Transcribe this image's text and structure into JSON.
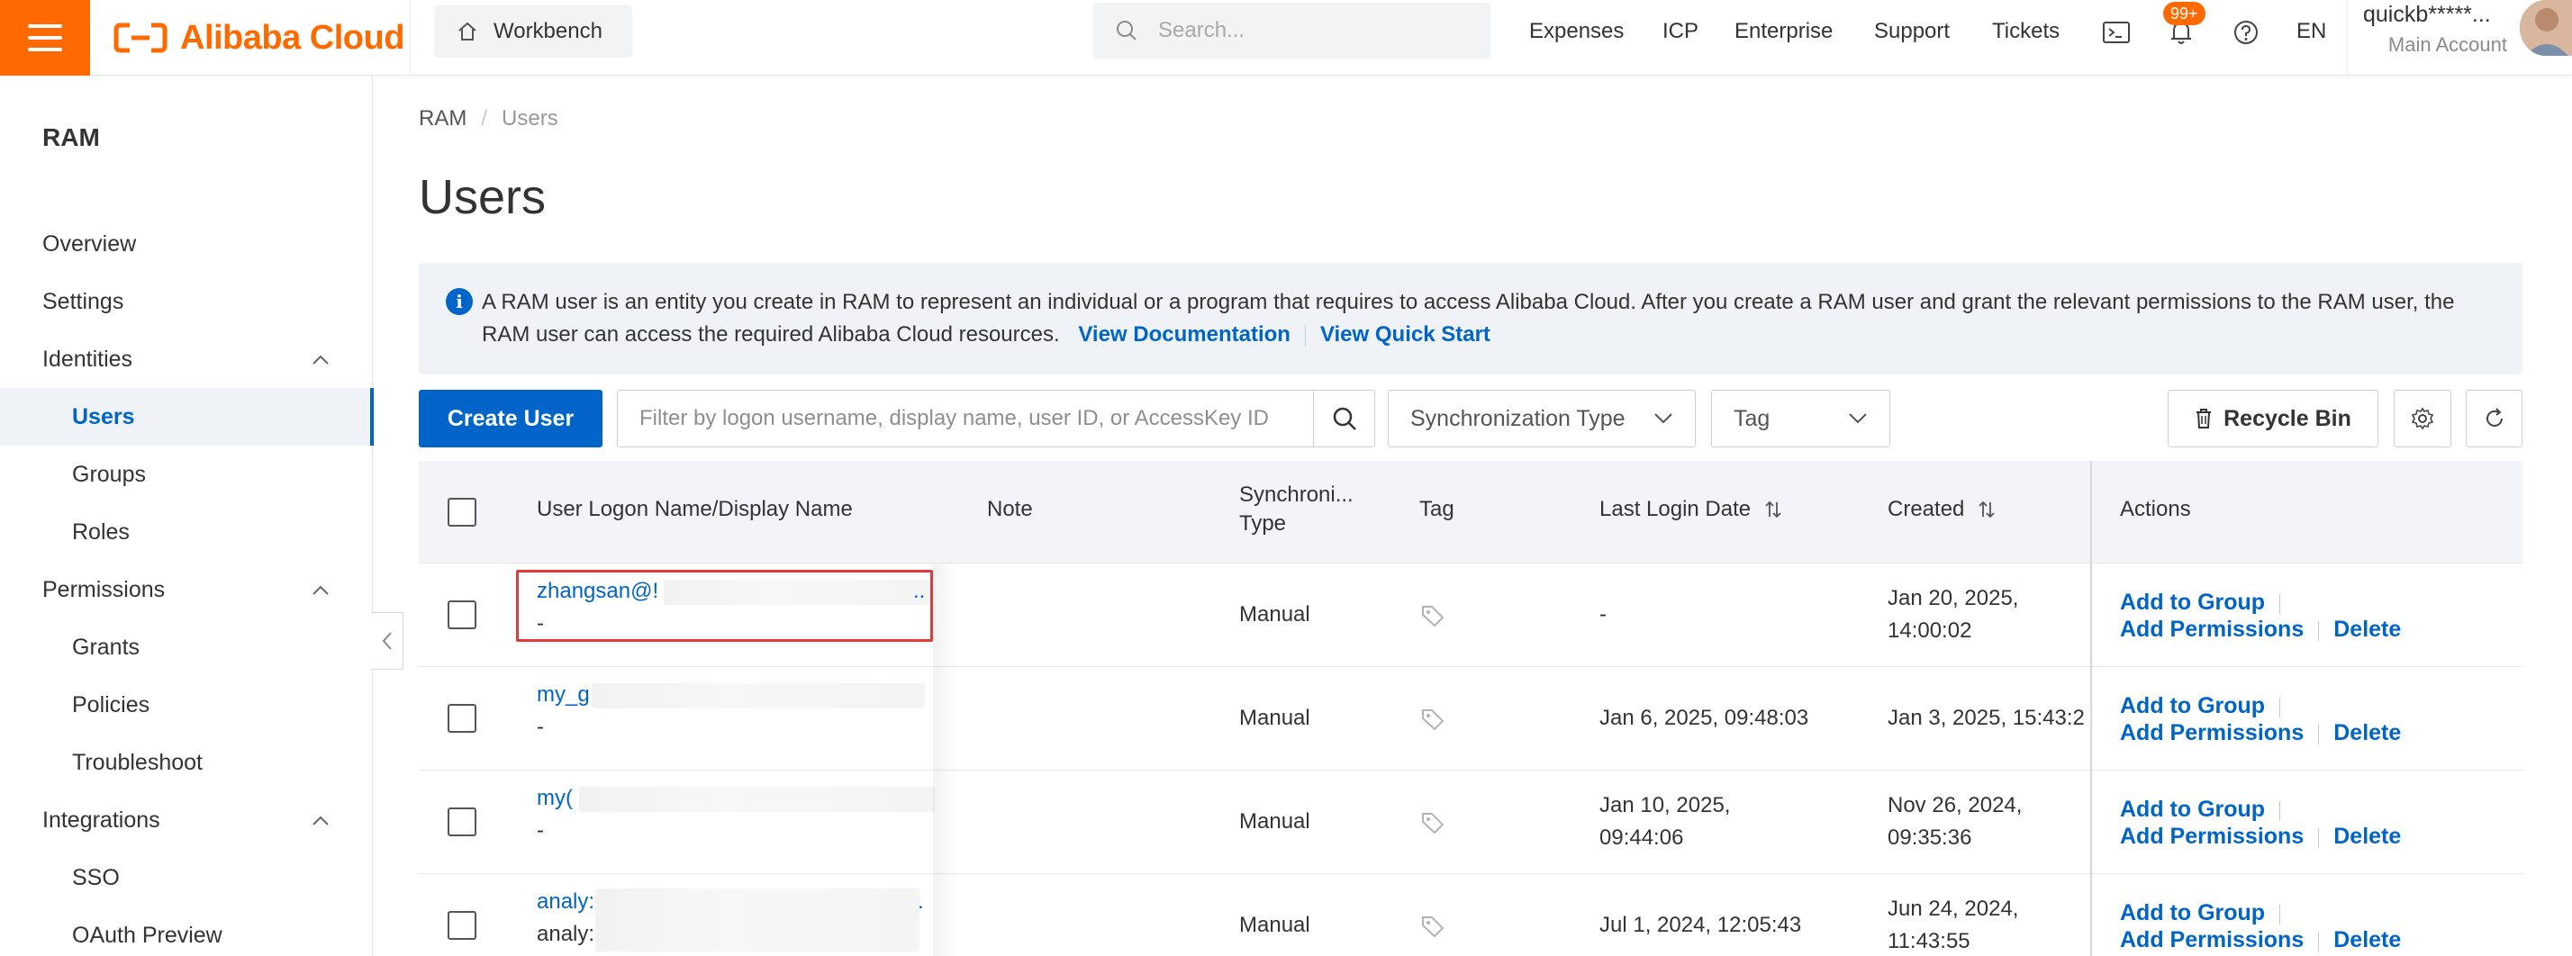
{
  "header": {
    "brand": "Alibaba Cloud",
    "workbench_label": "Workbench",
    "search_placeholder": "Search...",
    "nav": [
      "Expenses",
      "ICP",
      "Enterprise",
      "Support",
      "Tickets"
    ],
    "notification_badge": "99+",
    "language": "EN",
    "account_name": "quickb*****...",
    "account_type": "Main Account",
    "brand_color": "#ff6a00"
  },
  "sidebar": {
    "title": "RAM",
    "items": [
      {
        "label": "Overview",
        "kind": "top"
      },
      {
        "label": "Settings",
        "kind": "top"
      },
      {
        "label": "Identities",
        "kind": "group"
      },
      {
        "label": "Users",
        "kind": "sub",
        "active": true
      },
      {
        "label": "Groups",
        "kind": "sub"
      },
      {
        "label": "Roles",
        "kind": "sub"
      },
      {
        "label": "Permissions",
        "kind": "group"
      },
      {
        "label": "Grants",
        "kind": "sub"
      },
      {
        "label": "Policies",
        "kind": "sub"
      },
      {
        "label": "Troubleshoot",
        "kind": "sub"
      },
      {
        "label": "Integrations",
        "kind": "group"
      },
      {
        "label": "SSO",
        "kind": "sub"
      },
      {
        "label": "OAuth Preview",
        "kind": "sub"
      }
    ]
  },
  "breadcrumb": [
    "RAM",
    "Users"
  ],
  "page_title": "Users",
  "notice": {
    "text": "A RAM user is an entity you create in RAM to represent an individual or a program that requires to access Alibaba Cloud. After you create a RAM user and grant the relevant permissions to the RAM user, the RAM user can access the required Alibaba Cloud resources.",
    "link_docs": "View Documentation",
    "link_quickstart": "View Quick Start"
  },
  "toolbar": {
    "create_user": "Create User",
    "filter_placeholder": "Filter by logon username, display name, user ID, or AccessKey ID",
    "sync_type": "Synchronization Type",
    "tag": "Tag",
    "recycle_bin": "Recycle Bin"
  },
  "table": {
    "columns": {
      "name": "User Logon Name/Display Name",
      "note": "Note",
      "sync_line1": "Synchroni...",
      "sync_line2": "Type",
      "tag": "Tag",
      "last_login": "Last Login Date",
      "created": "Created",
      "actions": "Actions"
    },
    "actions": {
      "add_group": "Add to Group",
      "add_perm": "Add Permissions",
      "delete": "Delete"
    },
    "rows": [
      {
        "logon": "zhangsan@!",
        "display": "-",
        "trail": "..",
        "sync": "Manual",
        "last_login_1": "-",
        "last_login_2": "",
        "created_1": "Jan 20, 2025,",
        "created_2": "14:00:02"
      },
      {
        "logon": "my_g",
        "display": "-",
        "trail": "",
        "sync": "Manual",
        "last_login_1": "Jan 6, 2025, 09:48:03",
        "last_login_2": "",
        "created_1": "Jan 3, 2025, 15:43:2",
        "created_2": ""
      },
      {
        "logon": "my(",
        "display": "-",
        "trail": "",
        "sync": "Manual",
        "last_login_1": "Jan 10, 2025,",
        "last_login_2": "09:44:06",
        "created_1": "Nov 26, 2024,",
        "created_2": "09:35:36"
      },
      {
        "logon": "analy:",
        "display": "analy:",
        "trail": ".",
        "sync": "Manual",
        "last_login_1": "Jul 1, 2024, 12:05:43",
        "last_login_2": "",
        "created_1": "Jun 24, 2024,",
        "created_2": "11:43:55"
      }
    ]
  }
}
